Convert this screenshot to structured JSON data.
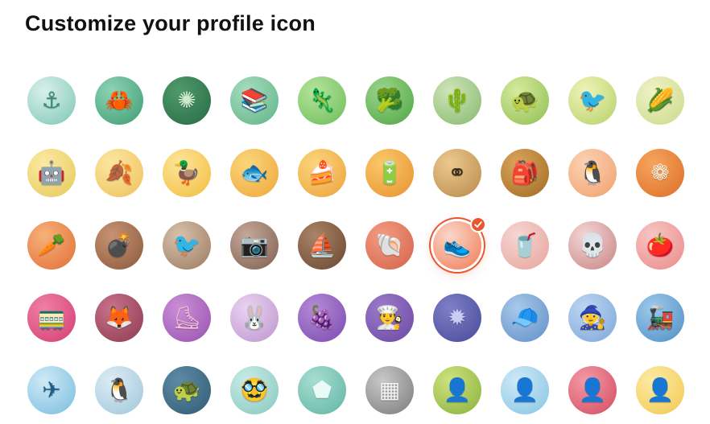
{
  "page": {
    "title": "Customize your profile icon",
    "accent": "#e8582f"
  },
  "icons": [
    {
      "name": "anchor",
      "glyph": "⚓",
      "c1": "#d9f0ea",
      "c2": "#7cc7b5",
      "fg": "#3a8a7a"
    },
    {
      "name": "crab",
      "glyph": "🦀",
      "c1": "#8fd3b4",
      "c2": "#3c9c73",
      "fg": "#ffffff"
    },
    {
      "name": "sea-urchin",
      "glyph": "✺",
      "c1": "#4f9a6c",
      "c2": "#276a45",
      "fg": "#cfe9cf"
    },
    {
      "name": "books",
      "glyph": "📚",
      "c1": "#a7dcbc",
      "c2": "#5fb48a",
      "fg": "#2c5f49"
    },
    {
      "name": "chameleon",
      "glyph": "🦎",
      "c1": "#b5e39a",
      "c2": "#6cbd5a",
      "fg": "#3f7d38"
    },
    {
      "name": "broccoli",
      "glyph": "🥦",
      "c1": "#9bd58b",
      "c2": "#4fa545",
      "fg": "#2d6e2b"
    },
    {
      "name": "cactus",
      "glyph": "🌵",
      "c1": "#cfe5b8",
      "c2": "#86b86e",
      "fg": "#4e8a45"
    },
    {
      "name": "turtle",
      "glyph": "🐢",
      "c1": "#d6ea9d",
      "c2": "#8fbf52",
      "fg": "#4f7a2a"
    },
    {
      "name": "bird",
      "glyph": "🐦",
      "c1": "#eef3b9",
      "c2": "#b7d167",
      "fg": "#3a6a2e"
    },
    {
      "name": "corn",
      "glyph": "🌽",
      "c1": "#eef2c6",
      "c2": "#cdd98a",
      "fg": "#6f8a2c"
    },
    {
      "name": "robot",
      "glyph": "🤖",
      "c1": "#fbeaa3",
      "c2": "#e6c95a",
      "fg": "#5a5a5a"
    },
    {
      "name": "leaf",
      "glyph": "🍂",
      "c1": "#fde6a3",
      "c2": "#eec15b",
      "fg": "#c98a2a"
    },
    {
      "name": "duck",
      "glyph": "🦆",
      "c1": "#fde49a",
      "c2": "#f1be3c",
      "fg": "#e0a21e"
    },
    {
      "name": "koi-fish",
      "glyph": "🐟",
      "c1": "#fbd57c",
      "c2": "#eea73a",
      "fg": "#ffffff"
    },
    {
      "name": "cake",
      "glyph": "🍰",
      "c1": "#fcd47b",
      "c2": "#eda33d",
      "fg": "#ffffff"
    },
    {
      "name": "battery",
      "glyph": "🔋",
      "c1": "#fbc86a",
      "c2": "#e69230",
      "fg": "#ffe2a0"
    },
    {
      "name": "binoculars",
      "glyph": "⚭",
      "c1": "#ecc98f",
      "c2": "#b8894a",
      "fg": "#3a2a1a"
    },
    {
      "name": "backpack",
      "glyph": "🎒",
      "c1": "#d9a55a",
      "c2": "#a26a24",
      "fg": "#f4d89a"
    },
    {
      "name": "penguin-red",
      "glyph": "🐧",
      "c1": "#fbd2b3",
      "c2": "#f0a06c",
      "fg": "#d24a2a"
    },
    {
      "name": "wreath",
      "glyph": "❁",
      "c1": "#f6a55e",
      "c2": "#dd6e26",
      "fg": "#fff1e0"
    },
    {
      "name": "carrot",
      "glyph": "🥕",
      "c1": "#f7b07a",
      "c2": "#e26f37",
      "fg": "#ffffff"
    },
    {
      "name": "bomb",
      "glyph": "💣",
      "c1": "#c79273",
      "c2": "#8a5a3c",
      "fg": "#3f2516"
    },
    {
      "name": "sparrow",
      "glyph": "🐦",
      "c1": "#d8c1ac",
      "c2": "#9c7a60",
      "fg": "#7b4a2a"
    },
    {
      "name": "camera",
      "glyph": "📷",
      "c1": "#c4a89a",
      "c2": "#7f5f4e",
      "fg": "#f5e9e0"
    },
    {
      "name": "ship",
      "glyph": "⛵",
      "c1": "#a98467",
      "c2": "#6a4630",
      "fg": "#f6e2b3"
    },
    {
      "name": "shell",
      "glyph": "🐚",
      "c1": "#f29c82",
      "c2": "#d4624a",
      "fg": "#ffffff"
    },
    {
      "name": "sneaker",
      "glyph": "👟",
      "c1": "#fbd7c9",
      "c2": "#f07a55",
      "fg": "#e8582f",
      "selected": true
    },
    {
      "name": "coffee-cup",
      "glyph": "🥤",
      "c1": "#f6d6d2",
      "c2": "#e7a39c",
      "fg": "#5a2e22"
    },
    {
      "name": "skull-helmet",
      "glyph": "💀",
      "c1": "#f4d5d5",
      "c2": "#c88484",
      "fg": "#8a5a5a"
    },
    {
      "name": "tomato",
      "glyph": "🍅",
      "c1": "#f7c6c4",
      "c2": "#e98a88",
      "fg": "#d8412c"
    },
    {
      "name": "train-cars",
      "glyph": "🚃",
      "c1": "#f07fa4",
      "c2": "#d23e74",
      "fg": "#ffffff"
    },
    {
      "name": "fox",
      "glyph": "🦊",
      "c1": "#c9728a",
      "c2": "#8c3b52",
      "fg": "#f6d0d8"
    },
    {
      "name": "roller-skate",
      "glyph": "⛸",
      "c1": "#cb8ed6",
      "c2": "#9852b0",
      "fg": "#f3c1d7"
    },
    {
      "name": "bunny-pot",
      "glyph": "🐰",
      "c1": "#ead3f0",
      "c2": "#bd94cf",
      "fg": "#8a55a8"
    },
    {
      "name": "grapes",
      "glyph": "🍇",
      "c1": "#b58ad6",
      "c2": "#7a4ab0",
      "fg": "#e9d3ff"
    },
    {
      "name": "chef-hat",
      "glyph": "👨‍🍳",
      "c1": "#9c7bc9",
      "c2": "#6a48a3",
      "fg": "#ffffff"
    },
    {
      "name": "urchin-shell",
      "glyph": "✹",
      "c1": "#7e7fc6",
      "c2": "#474a9a",
      "fg": "#c9cdf4"
    },
    {
      "name": "beanie",
      "glyph": "🧢",
      "c1": "#a8c9ea",
      "c2": "#5f8fc8",
      "fg": "#e7503a"
    },
    {
      "name": "gnome",
      "glyph": "🧙",
      "c1": "#bcd6f1",
      "c2": "#7ea6da",
      "fg": "#d23a2a"
    },
    {
      "name": "train",
      "glyph": "🚂",
      "c1": "#9fc9ea",
      "c2": "#4d8fc5",
      "fg": "#ffffff"
    },
    {
      "name": "paper-plane",
      "glyph": "✈",
      "c1": "#cfe9f6",
      "c2": "#79bde0",
      "fg": "#1f5f88"
    },
    {
      "name": "penguin",
      "glyph": "🐧",
      "c1": "#dcecf4",
      "c2": "#9fc6da",
      "fg": "#2a3a4a"
    },
    {
      "name": "tortoise",
      "glyph": "🐢",
      "c1": "#5d8aa5",
      "c2": "#325c75",
      "fg": "#f1c84b"
    },
    {
      "name": "disguise-glasses",
      "glyph": "🥸",
      "c1": "#c9ebe7",
      "c2": "#86c8bf",
      "fg": "#2a2a2a"
    },
    {
      "name": "puzzle-piece",
      "glyph": "⬟",
      "c1": "#a7ddd2",
      "c2": "#5fb5a4",
      "fg": "#e8fbf6"
    },
    {
      "name": "cheese-grater",
      "glyph": "▦",
      "c1": "#c9c9c9",
      "c2": "#7a7a7a",
      "fg": "#f2f2f2"
    },
    {
      "name": "head-green",
      "glyph": "👤",
      "c1": "#cfe27f",
      "c2": "#88b13a",
      "fg": "#1a5a6a"
    },
    {
      "name": "head-blue",
      "glyph": "👤",
      "c1": "#cfe9f6",
      "c2": "#86c4e4",
      "fg": "#1a5a78"
    },
    {
      "name": "head-red",
      "glyph": "👤",
      "c1": "#f49aa5",
      "c2": "#d24b60",
      "fg": "#1a5a6a"
    },
    {
      "name": "head-yellow",
      "glyph": "👤",
      "c1": "#fdeaa6",
      "c2": "#f1c94f",
      "fg": "#1a5a6a"
    }
  ]
}
